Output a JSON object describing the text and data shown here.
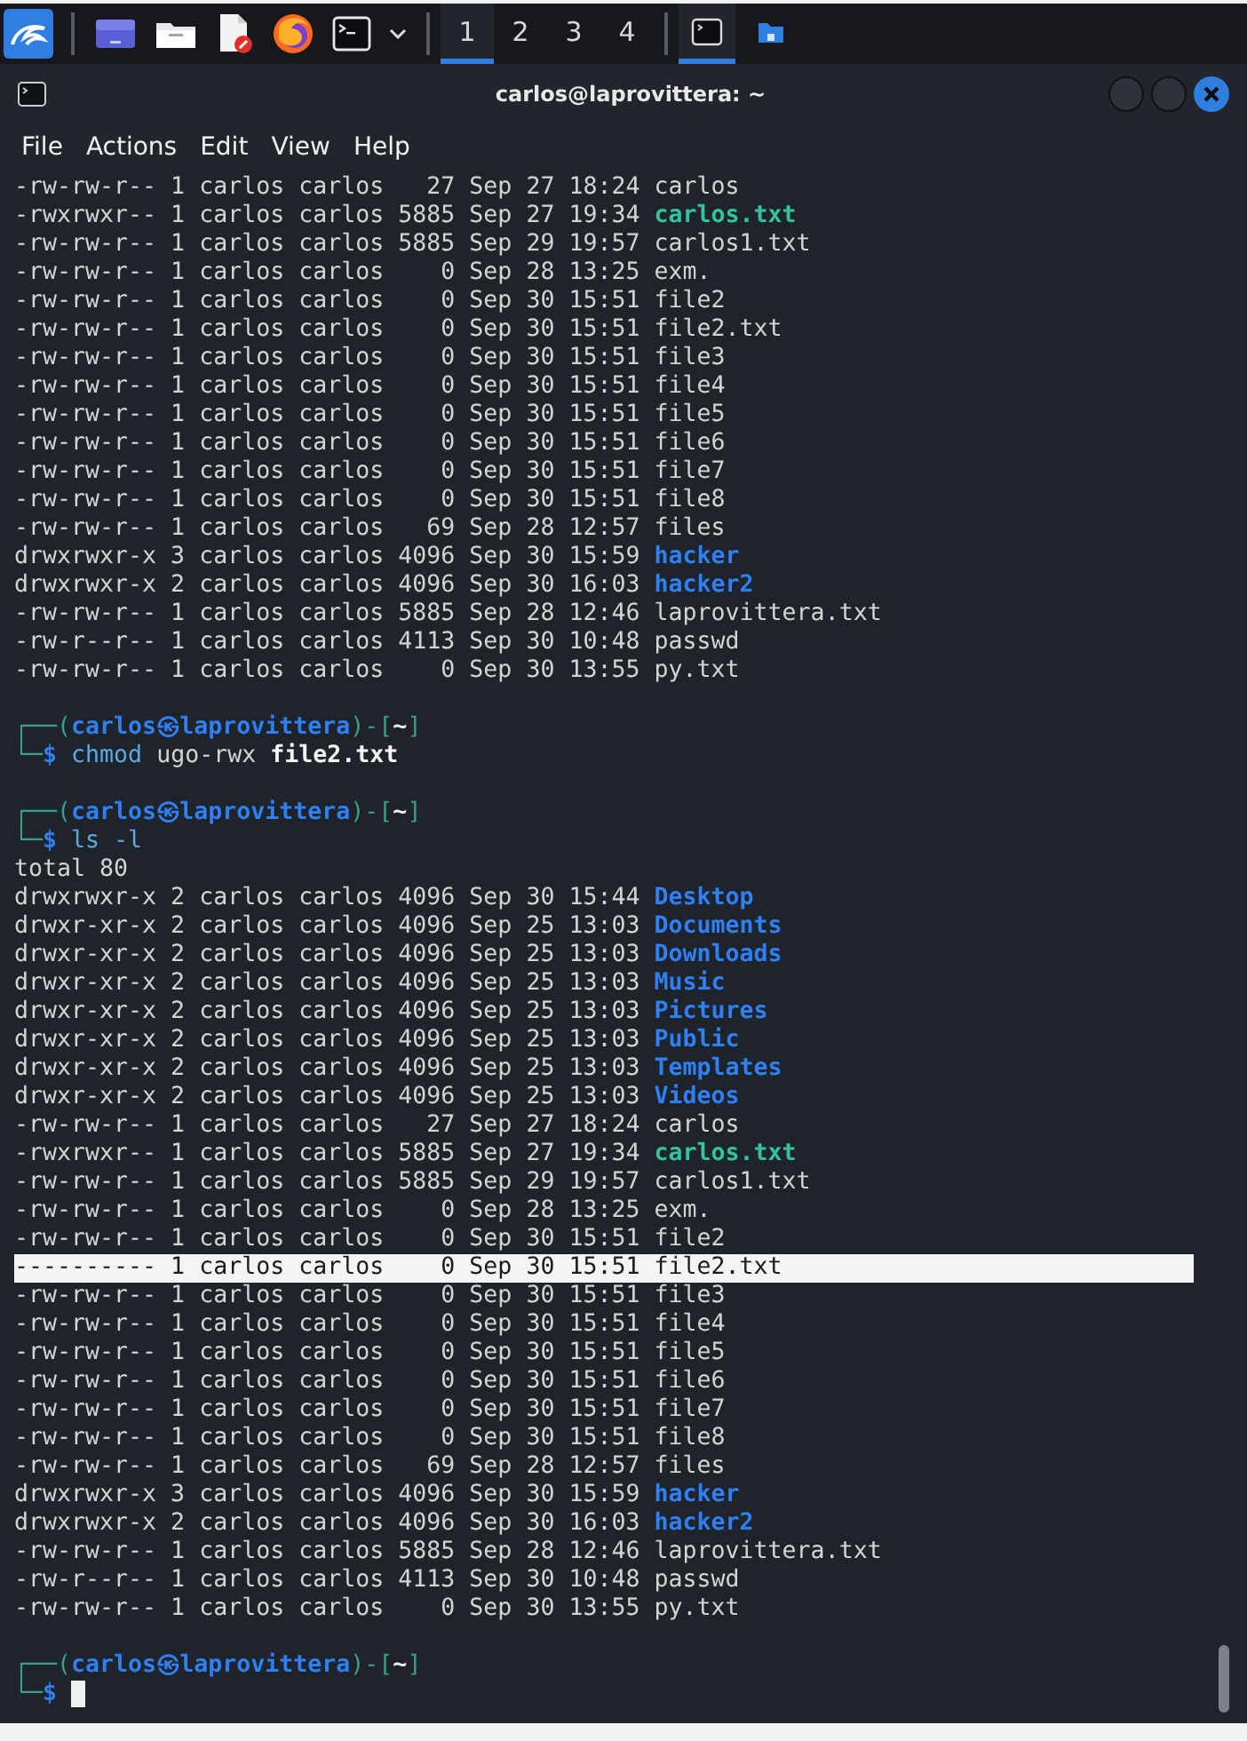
{
  "taskbar": {
    "launchers": [
      {
        "kind": "desktop"
      },
      {
        "kind": "files"
      },
      {
        "kind": "editor"
      },
      {
        "kind": "browser"
      },
      {
        "kind": "terminal",
        "dropdown": true
      }
    ],
    "workspaces": [
      {
        "label": "1",
        "selected": true
      },
      {
        "label": "2",
        "selected": false
      },
      {
        "label": "3",
        "selected": false
      },
      {
        "label": "4",
        "selected": false
      }
    ],
    "tasks": [
      {
        "kind": "terminal",
        "selected": true
      },
      {
        "kind": "files",
        "selected": false
      }
    ]
  },
  "window": {
    "title": "carlos@laprovittera: ~",
    "menu": [
      "File",
      "Actions",
      "Edit",
      "View",
      "Help"
    ]
  },
  "terminal": {
    "lines": [
      {
        "kind": "listing",
        "meta": "-rw-rw-r-- 1 carlos carlos   27 Sep 27 18:24",
        "name": {
          "text": "carlos",
          "kind": "file"
        },
        "selected": false
      },
      {
        "kind": "listing",
        "meta": "-rwxrwxr-- 1 carlos carlos 5885 Sep 27 19:34",
        "name": {
          "text": "carlos.txt",
          "kind": "exec"
        },
        "selected": false
      },
      {
        "kind": "listing",
        "meta": "-rw-rw-r-- 1 carlos carlos 5885 Sep 29 19:57",
        "name": {
          "text": "carlos1.txt",
          "kind": "file"
        },
        "selected": false
      },
      {
        "kind": "listing",
        "meta": "-rw-rw-r-- 1 carlos carlos    0 Sep 28 13:25",
        "name": {
          "text": "exm.",
          "kind": "file"
        },
        "selected": false
      },
      {
        "kind": "listing",
        "meta": "-rw-rw-r-- 1 carlos carlos    0 Sep 30 15:51",
        "name": {
          "text": "file2",
          "kind": "file"
        },
        "selected": false
      },
      {
        "kind": "listing",
        "meta": "-rw-rw-r-- 1 carlos carlos    0 Sep 30 15:51",
        "name": {
          "text": "file2.txt",
          "kind": "file"
        },
        "selected": false
      },
      {
        "kind": "listing",
        "meta": "-rw-rw-r-- 1 carlos carlos    0 Sep 30 15:51",
        "name": {
          "text": "file3",
          "kind": "file"
        },
        "selected": false
      },
      {
        "kind": "listing",
        "meta": "-rw-rw-r-- 1 carlos carlos    0 Sep 30 15:51",
        "name": {
          "text": "file4",
          "kind": "file"
        },
        "selected": false
      },
      {
        "kind": "listing",
        "meta": "-rw-rw-r-- 1 carlos carlos    0 Sep 30 15:51",
        "name": {
          "text": "file5",
          "kind": "file"
        },
        "selected": false
      },
      {
        "kind": "listing",
        "meta": "-rw-rw-r-- 1 carlos carlos    0 Sep 30 15:51",
        "name": {
          "text": "file6",
          "kind": "file"
        },
        "selected": false
      },
      {
        "kind": "listing",
        "meta": "-rw-rw-r-- 1 carlos carlos    0 Sep 30 15:51",
        "name": {
          "text": "file7",
          "kind": "file"
        },
        "selected": false
      },
      {
        "kind": "listing",
        "meta": "-rw-rw-r-- 1 carlos carlos    0 Sep 30 15:51",
        "name": {
          "text": "file8",
          "kind": "file"
        },
        "selected": false
      },
      {
        "kind": "listing",
        "meta": "-rw-rw-r-- 1 carlos carlos   69 Sep 28 12:57",
        "name": {
          "text": "files",
          "kind": "file"
        },
        "selected": false
      },
      {
        "kind": "listing",
        "meta": "drwxrwxr-x 3 carlos carlos 4096 Sep 30 15:59",
        "name": {
          "text": "hacker",
          "kind": "dir"
        },
        "selected": false
      },
      {
        "kind": "listing",
        "meta": "drwxrwxr-x 2 carlos carlos 4096 Sep 30 16:03",
        "name": {
          "text": "hacker2",
          "kind": "dir"
        },
        "selected": false
      },
      {
        "kind": "listing",
        "meta": "-rw-rw-r-- 1 carlos carlos 5885 Sep 28 12:46",
        "name": {
          "text": "laprovittera.txt",
          "kind": "file"
        },
        "selected": false
      },
      {
        "kind": "listing",
        "meta": "-rw-r--r-- 1 carlos carlos 4113 Sep 30 10:48",
        "name": {
          "text": "passwd",
          "kind": "file"
        },
        "selected": false
      },
      {
        "kind": "listing",
        "meta": "-rw-rw-r-- 1 carlos carlos    0 Sep 30 13:55",
        "name": {
          "text": "py.txt",
          "kind": "file"
        },
        "selected": false
      },
      {
        "kind": "blank"
      },
      {
        "kind": "prompt",
        "segments": [
          {
            "text": "┌──(",
            "kind": "frame"
          },
          {
            "text": "carlos㉿laprovittera",
            "kind": "userhost"
          },
          {
            "text": ")-[",
            "kind": "frame"
          },
          {
            "text": "~",
            "kind": "dir"
          },
          {
            "text": "]",
            "kind": "frame"
          }
        ]
      },
      {
        "kind": "input",
        "segments": [
          {
            "text": "└─",
            "kind": "frame"
          },
          {
            "text": "$",
            "kind": "sigil"
          },
          {
            "text": "chmod",
            "kind": "command"
          },
          {
            "text": "ugo-rwx",
            "kind": "arg"
          },
          {
            "text": "file2.txt",
            "kind": "path"
          }
        ],
        "cursor": false
      },
      {
        "kind": "blank"
      },
      {
        "kind": "prompt",
        "segments": [
          {
            "text": "┌──(",
            "kind": "frame"
          },
          {
            "text": "carlos㉿laprovittera",
            "kind": "userhost"
          },
          {
            "text": ")-[",
            "kind": "frame"
          },
          {
            "text": "~",
            "kind": "dir"
          },
          {
            "text": "]",
            "kind": "frame"
          }
        ]
      },
      {
        "kind": "input",
        "segments": [
          {
            "text": "└─",
            "kind": "frame"
          },
          {
            "text": "$",
            "kind": "sigil"
          },
          {
            "text": "ls",
            "kind": "command"
          },
          {
            "text": "-l",
            "kind": "option"
          }
        ],
        "cursor": false
      },
      {
        "kind": "output",
        "text": "total 80"
      },
      {
        "kind": "listing",
        "meta": "drwxrwxr-x 2 carlos carlos 4096 Sep 30 15:44",
        "name": {
          "text": "Desktop",
          "kind": "dir"
        },
        "selected": false
      },
      {
        "kind": "listing",
        "meta": "drwxr-xr-x 2 carlos carlos 4096 Sep 25 13:03",
        "name": {
          "text": "Documents",
          "kind": "dir"
        },
        "selected": false
      },
      {
        "kind": "listing",
        "meta": "drwxr-xr-x 2 carlos carlos 4096 Sep 25 13:03",
        "name": {
          "text": "Downloads",
          "kind": "dir"
        },
        "selected": false
      },
      {
        "kind": "listing",
        "meta": "drwxr-xr-x 2 carlos carlos 4096 Sep 25 13:03",
        "name": {
          "text": "Music",
          "kind": "dir"
        },
        "selected": false
      },
      {
        "kind": "listing",
        "meta": "drwxr-xr-x 2 carlos carlos 4096 Sep 25 13:03",
        "name": {
          "text": "Pictures",
          "kind": "dir"
        },
        "selected": false
      },
      {
        "kind": "listing",
        "meta": "drwxr-xr-x 2 carlos carlos 4096 Sep 25 13:03",
        "name": {
          "text": "Public",
          "kind": "dir"
        },
        "selected": false
      },
      {
        "kind": "listing",
        "meta": "drwxr-xr-x 2 carlos carlos 4096 Sep 25 13:03",
        "name": {
          "text": "Templates",
          "kind": "dir"
        },
        "selected": false
      },
      {
        "kind": "listing",
        "meta": "drwxr-xr-x 2 carlos carlos 4096 Sep 25 13:03",
        "name": {
          "text": "Videos",
          "kind": "dir"
        },
        "selected": false
      },
      {
        "kind": "listing",
        "meta": "-rw-rw-r-- 1 carlos carlos   27 Sep 27 18:24",
        "name": {
          "text": "carlos",
          "kind": "file"
        },
        "selected": false
      },
      {
        "kind": "listing",
        "meta": "-rwxrwxr-- 1 carlos carlos 5885 Sep 27 19:34",
        "name": {
          "text": "carlos.txt",
          "kind": "exec"
        },
        "selected": false
      },
      {
        "kind": "listing",
        "meta": "-rw-rw-r-- 1 carlos carlos 5885 Sep 29 19:57",
        "name": {
          "text": "carlos1.txt",
          "kind": "file"
        },
        "selected": false
      },
      {
        "kind": "listing",
        "meta": "-rw-rw-r-- 1 carlos carlos    0 Sep 28 13:25",
        "name": {
          "text": "exm.",
          "kind": "file"
        },
        "selected": false
      },
      {
        "kind": "listing",
        "meta": "-rw-rw-r-- 1 carlos carlos    0 Sep 30 15:51",
        "name": {
          "text": "file2",
          "kind": "file"
        },
        "selected": false
      },
      {
        "kind": "listing",
        "meta": "---------- 1 carlos carlos    0 Sep 30 15:51",
        "name": {
          "text": "file2.txt",
          "kind": "file"
        },
        "selected": true
      },
      {
        "kind": "listing",
        "meta": "-rw-rw-r-- 1 carlos carlos    0 Sep 30 15:51",
        "name": {
          "text": "file3",
          "kind": "file"
        },
        "selected": false
      },
      {
        "kind": "listing",
        "meta": "-rw-rw-r-- 1 carlos carlos    0 Sep 30 15:51",
        "name": {
          "text": "file4",
          "kind": "file"
        },
        "selected": false
      },
      {
        "kind": "listing",
        "meta": "-rw-rw-r-- 1 carlos carlos    0 Sep 30 15:51",
        "name": {
          "text": "file5",
          "kind": "file"
        },
        "selected": false
      },
      {
        "kind": "listing",
        "meta": "-rw-rw-r-- 1 carlos carlos    0 Sep 30 15:51",
        "name": {
          "text": "file6",
          "kind": "file"
        },
        "selected": false
      },
      {
        "kind": "listing",
        "meta": "-rw-rw-r-- 1 carlos carlos    0 Sep 30 15:51",
        "name": {
          "text": "file7",
          "kind": "file"
        },
        "selected": false
      },
      {
        "kind": "listing",
        "meta": "-rw-rw-r-- 1 carlos carlos    0 Sep 30 15:51",
        "name": {
          "text": "file8",
          "kind": "file"
        },
        "selected": false
      },
      {
        "kind": "listing",
        "meta": "-rw-rw-r-- 1 carlos carlos   69 Sep 28 12:57",
        "name": {
          "text": "files",
          "kind": "file"
        },
        "selected": false
      },
      {
        "kind": "listing",
        "meta": "drwxrwxr-x 3 carlos carlos 4096 Sep 30 15:59",
        "name": {
          "text": "hacker",
          "kind": "dir"
        },
        "selected": false
      },
      {
        "kind": "listing",
        "meta": "drwxrwxr-x 2 carlos carlos 4096 Sep 30 16:03",
        "name": {
          "text": "hacker2",
          "kind": "dir"
        },
        "selected": false
      },
      {
        "kind": "listing",
        "meta": "-rw-rw-r-- 1 carlos carlos 5885 Sep 28 12:46",
        "name": {
          "text": "laprovittera.txt",
          "kind": "file"
        },
        "selected": false
      },
      {
        "kind": "listing",
        "meta": "-rw-r--r-- 1 carlos carlos 4113 Sep 30 10:48",
        "name": {
          "text": "passwd",
          "kind": "file"
        },
        "selected": false
      },
      {
        "kind": "listing",
        "meta": "-rw-rw-r-- 1 carlos carlos    0 Sep 30 13:55",
        "name": {
          "text": "py.txt",
          "kind": "file"
        },
        "selected": false
      },
      {
        "kind": "blank"
      },
      {
        "kind": "prompt",
        "segments": [
          {
            "text": "┌──(",
            "kind": "frame"
          },
          {
            "text": "carlos㉿laprovittera",
            "kind": "userhost"
          },
          {
            "text": ")-[",
            "kind": "frame"
          },
          {
            "text": "~",
            "kind": "dir"
          },
          {
            "text": "]",
            "kind": "frame"
          }
        ]
      },
      {
        "kind": "input",
        "segments": [
          {
            "text": "└─",
            "kind": "frame"
          },
          {
            "text": "$",
            "kind": "sigil"
          }
        ],
        "cursor": true
      }
    ]
  }
}
